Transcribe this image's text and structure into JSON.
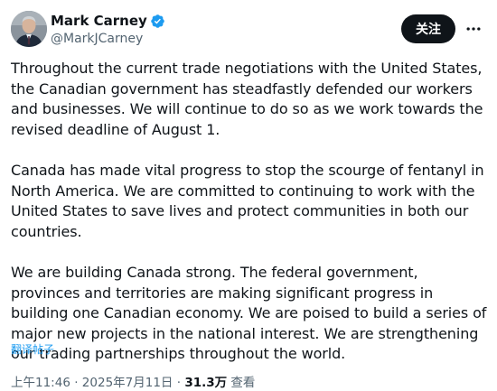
{
  "author": {
    "name": "Mark Carney",
    "handle": "@MarkJCarney",
    "verified": true,
    "follow_label": "关注"
  },
  "tweet": {
    "paragraphs": [
      "Throughout the current trade negotiations with the United States, the Canadian government has steadfastly defended our workers and businesses. We will continue to do so as we work towards the revised deadline of August 1.",
      "Canada has made vital progress to stop the scourge of fentanyl in North America. We are committed to continuing to work with the United States to save lives and protect communities in both our countries.",
      "We are building Canada strong. The federal government, provinces and territories are making significant progress in building one Canadian economy. We are poised to build a series of major new projects in the national interest. We are strengthening our trading partnerships throughout the world."
    ],
    "translate_label": "翻译帖子"
  },
  "meta": {
    "time": "上午11:46",
    "separator": "·",
    "date": "2025年7月11日",
    "views_count": "31.3万",
    "views_label": "查看"
  },
  "colors": {
    "accent": "#1d9bf0",
    "text": "#0f1419",
    "secondary": "#536471",
    "follow_bg": "#0f1419"
  },
  "icons": {
    "verified": "verified-badge-icon",
    "more": "more-options-icon"
  }
}
